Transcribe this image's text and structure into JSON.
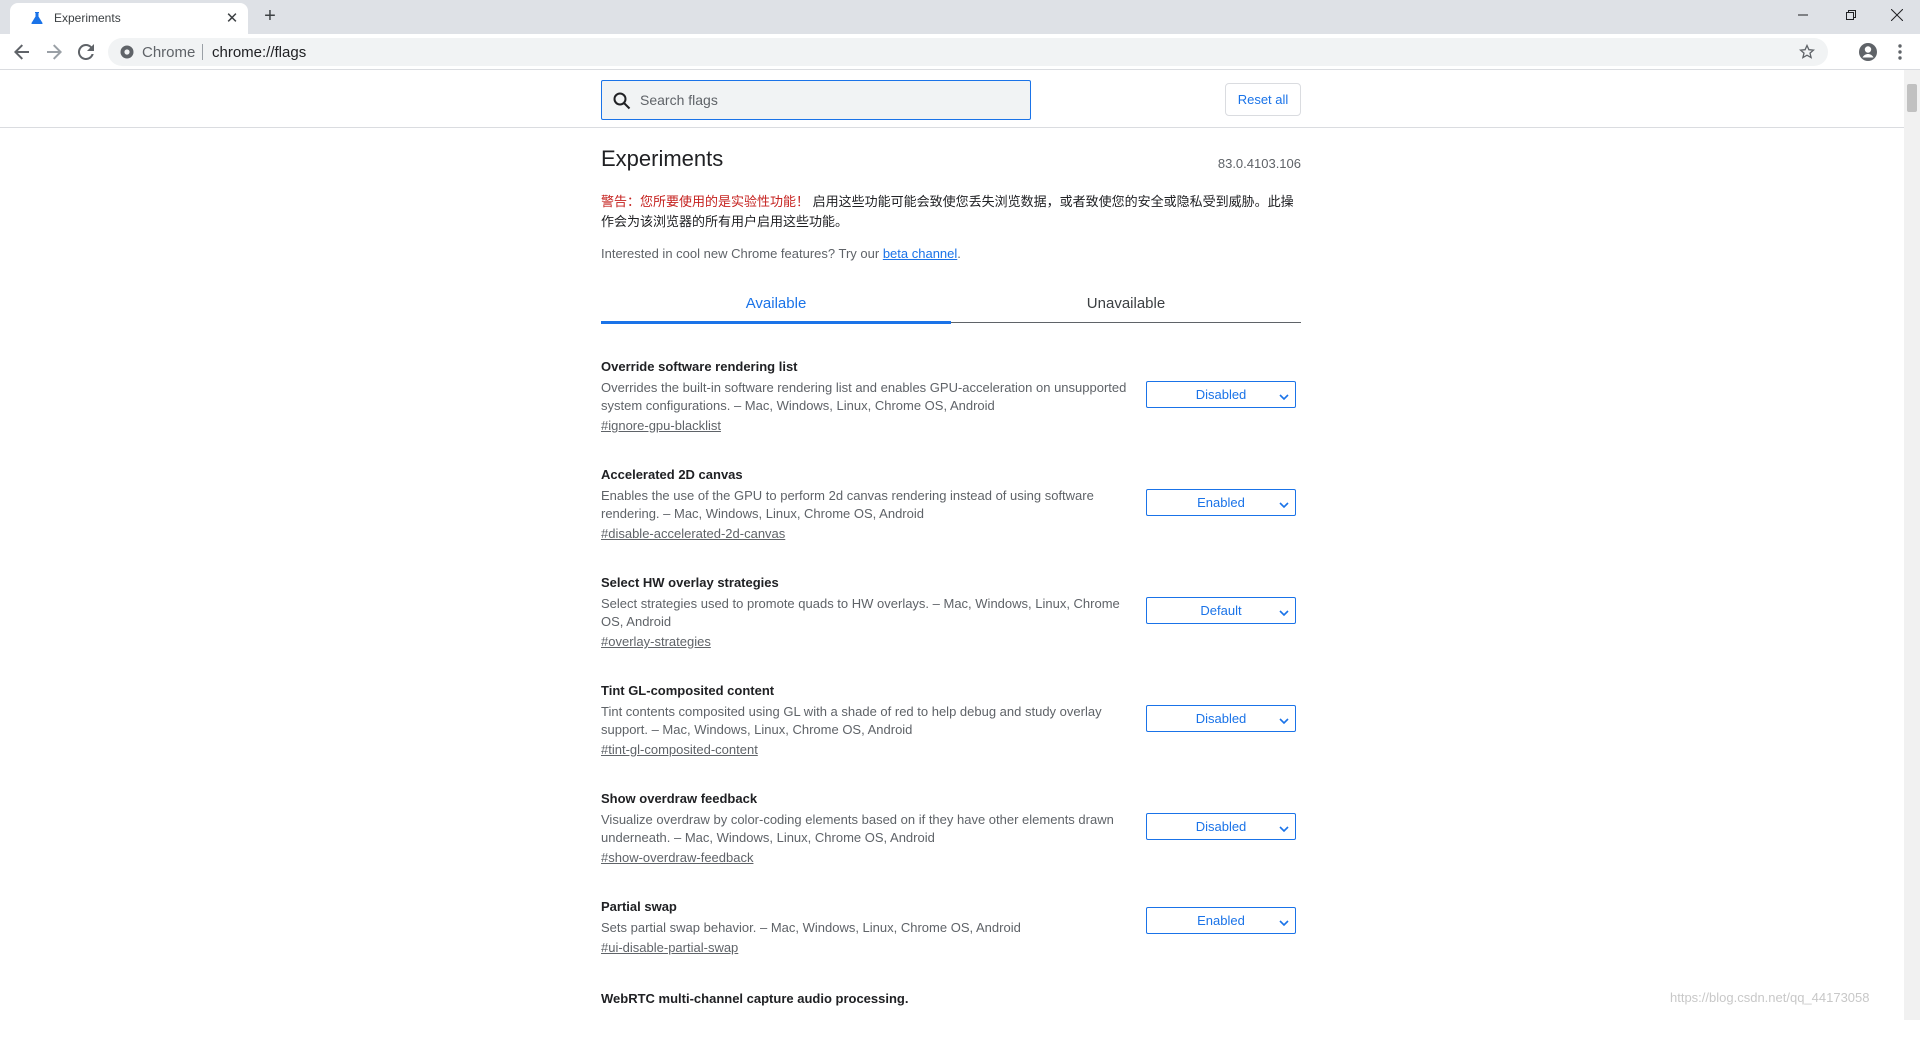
{
  "browser": {
    "tab_title": "Experiments",
    "omnibox_chip": "Chrome",
    "url": "chrome://flags"
  },
  "header": {
    "search_placeholder": "Search flags",
    "reset_label": "Reset all"
  },
  "page": {
    "title": "Experiments",
    "version": "83.0.4103.106",
    "warning_label": "警告：您所要使用的是实验性功能！",
    "warning_text": "启用这些功能可能会致使您丢失浏览数据，或者致使您的安全或隐私受到威胁。此操作会为该浏览器的所有用户启用这些功能。",
    "interest_text": "Interested in cool new Chrome features? Try our",
    "interest_link": "beta channel",
    "interest_end": "."
  },
  "tabs": {
    "available": "Available",
    "unavailable": "Unavailable"
  },
  "experiments": [
    {
      "name": "Override software rendering list",
      "desc": "Overrides the built-in software rendering list and enables GPU-acceleration on unsupported system configurations. – Mac, Windows, Linux, Chrome OS, Android",
      "link": "#ignore-gpu-blacklist",
      "value": "Disabled"
    },
    {
      "name": "Accelerated 2D canvas",
      "desc": "Enables the use of the GPU to perform 2d canvas rendering instead of using software rendering. – Mac, Windows, Linux, Chrome OS, Android",
      "link": "#disable-accelerated-2d-canvas",
      "value": "Enabled"
    },
    {
      "name": "Select HW overlay strategies",
      "desc": "Select strategies used to promote quads to HW overlays. – Mac, Windows, Linux, Chrome OS, Android",
      "link": "#overlay-strategies",
      "value": "Default"
    },
    {
      "name": "Tint GL-composited content",
      "desc": "Tint contents composited using GL with a shade of red to help debug and study overlay support. – Mac, Windows, Linux, Chrome OS, Android",
      "link": "#tint-gl-composited-content",
      "value": "Disabled"
    },
    {
      "name": "Show overdraw feedback",
      "desc": "Visualize overdraw by color-coding elements based on if they have other elements drawn underneath. – Mac, Windows, Linux, Chrome OS, Android",
      "link": "#show-overdraw-feedback",
      "value": "Disabled"
    },
    {
      "name": "Partial swap",
      "desc": "Sets partial swap behavior. – Mac, Windows, Linux, Chrome OS, Android",
      "link": "#ui-disable-partial-swap",
      "value": "Enabled"
    },
    {
      "name": "WebRTC multi-channel capture audio processing.",
      "desc": "",
      "link": "",
      "value": ""
    }
  ],
  "watermark": "https://blog.csdn.net/qq_44173058",
  "colors": {
    "accent": "#1a73e8",
    "warning": "#c5221f",
    "tabstrip": "#dee1e6"
  }
}
